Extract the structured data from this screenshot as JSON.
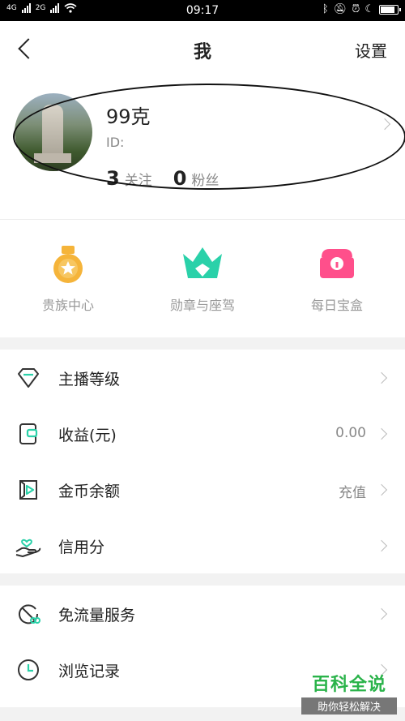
{
  "status_bar": {
    "network_left": "4G",
    "network_right": "2G",
    "time": "09:17",
    "battery_level": 0.85
  },
  "header": {
    "title": "我",
    "settings_label": "设置"
  },
  "profile": {
    "nickname": "99克",
    "id_label": "ID:",
    "following_count": "3",
    "following_label": "关注",
    "followers_count": "0",
    "followers_label": "粉丝"
  },
  "shortcuts": [
    {
      "label": "贵族中心",
      "icon": "noble-medal-icon",
      "color": "#f5b43a"
    },
    {
      "label": "勋章与座驾",
      "icon": "crown-icon",
      "color": "#2ad1a9"
    },
    {
      "label": "每日宝盒",
      "icon": "treasure-box-icon",
      "color": "#ff4f8b"
    }
  ],
  "menu_section_1": [
    {
      "label": "主播等级",
      "value": "",
      "icon": "diamond-icon"
    },
    {
      "label": "收益(元)",
      "value": "0.00",
      "icon": "wallet-icon"
    },
    {
      "label": "金币余额",
      "value": "充值",
      "icon": "coin-play-icon"
    },
    {
      "label": "信用分",
      "value": "",
      "icon": "heart-hand-icon"
    }
  ],
  "menu_section_2": [
    {
      "label": "免流量服务",
      "value": "",
      "icon": "data-free-icon"
    },
    {
      "label": "浏览记录",
      "value": "",
      "icon": "clock-icon"
    }
  ],
  "watermark": {
    "title": "百科全说",
    "subtitle": "助你轻松解决"
  },
  "colors": {
    "accent": "#2ad1a9",
    "icon_dark": "#333333",
    "background": "#f2f2f2"
  }
}
